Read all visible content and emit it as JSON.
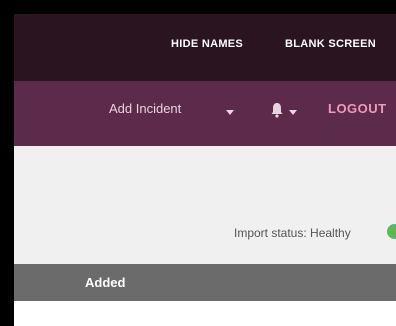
{
  "top_bar": {
    "hide_names_label": "HIDE NAMES",
    "blank_screen_label": "BLANK SCREEN"
  },
  "nav": {
    "add_incident_label": "Add Incident",
    "logout_label": "LOGOUT",
    "bell_icon": "bell-icon"
  },
  "status": {
    "import_label": "Import status: Healthy",
    "color": "#5cb85c"
  },
  "table": {
    "columns": [
      "Added"
    ]
  },
  "colors": {
    "top_bar": "#2a1420",
    "nav_bar": "#5c2a4a",
    "logout": "#f09abb",
    "table_header": "#6b6b6b"
  }
}
